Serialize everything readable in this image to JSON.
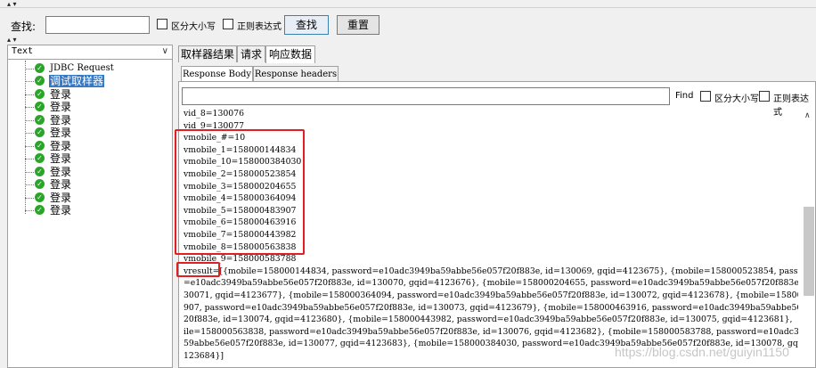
{
  "search": {
    "label": "查找:",
    "input_value": "",
    "case_label": "区分大小写",
    "regex_label": "正则表达式",
    "find_button": "查找",
    "reset_button": "重置"
  },
  "tree": {
    "dropdown_label": "Text",
    "items": [
      {
        "label": "JDBC Request"
      },
      {
        "label": "调试取样器"
      },
      {
        "label": "登录"
      },
      {
        "label": "登录"
      },
      {
        "label": "登录"
      },
      {
        "label": "登录"
      },
      {
        "label": "登录"
      },
      {
        "label": "登录"
      },
      {
        "label": "登录"
      },
      {
        "label": "登录"
      },
      {
        "label": "登录"
      },
      {
        "label": "登录"
      }
    ]
  },
  "tabs": [
    "取样器结果",
    "请求",
    "响应数据"
  ],
  "subtabs": [
    "Response Body",
    "Response headers"
  ],
  "find": {
    "label": "Find",
    "case_label": "区分大小写",
    "regex_label": "正则表达式"
  },
  "response_lines": [
    "vid_8=130076",
    "vid_9=130077",
    "vmobile_#=10",
    "vmobile_1=158000144834",
    "vmobile_10=158000384030",
    "vmobile_2=158000523854",
    "vmobile_3=158000204655",
    "vmobile_4=158000364094",
    "vmobile_5=158000483907",
    "vmobile_6=158000463916",
    "vmobile_7=158000443982",
    "vmobile_8=158000563838",
    "vmobile_9=158000583788",
    "vresult=[{mobile=158000144834, password=e10adc3949ba59abbe56e057f20f883e, id=130069, gqid=4123675}, {mobile=158000523854, passw",
    "=e10adc3949ba59abbe56e057f20f883e, id=130070, gqid=4123676}, {mobile=158000204655, password=e10adc3949ba59abbe56e057f20f883e,",
    "30071, gqid=4123677}, {mobile=158000364094, password=e10adc3949ba59abbe56e057f20f883e, id=130072, gqid=4123678}, {mobile=15800",
    "907, password=e10adc3949ba59abbe56e057f20f883e, id=130073, gqid=4123679}, {mobile=158000463916, password=e10adc3949ba59abbe56e",
    "20f883e, id=130074, gqid=4123680}, {mobile=158000443982, password=e10adc3949ba59abbe56e057f20f883e, id=130075, gqid=4123681},",
    "ile=158000563838, password=e10adc3949ba59abbe56e057f20f883e, id=130076, gqid=4123682}, {mobile=158000583788, password=e10adc39",
    "59abbe56e057f20f883e, id=130077, gqid=4123683}, {mobile=158000384030, password=e10adc3949ba59abbe56e057f20f883e, id=130078, gq",
    "123684}]"
  ],
  "watermark": "https://blog.csdn.net/guiyin1150",
  "colors": {
    "highlight_box": "#e02020",
    "selection": "#3478c6",
    "check_icon": "#2aa52a"
  }
}
